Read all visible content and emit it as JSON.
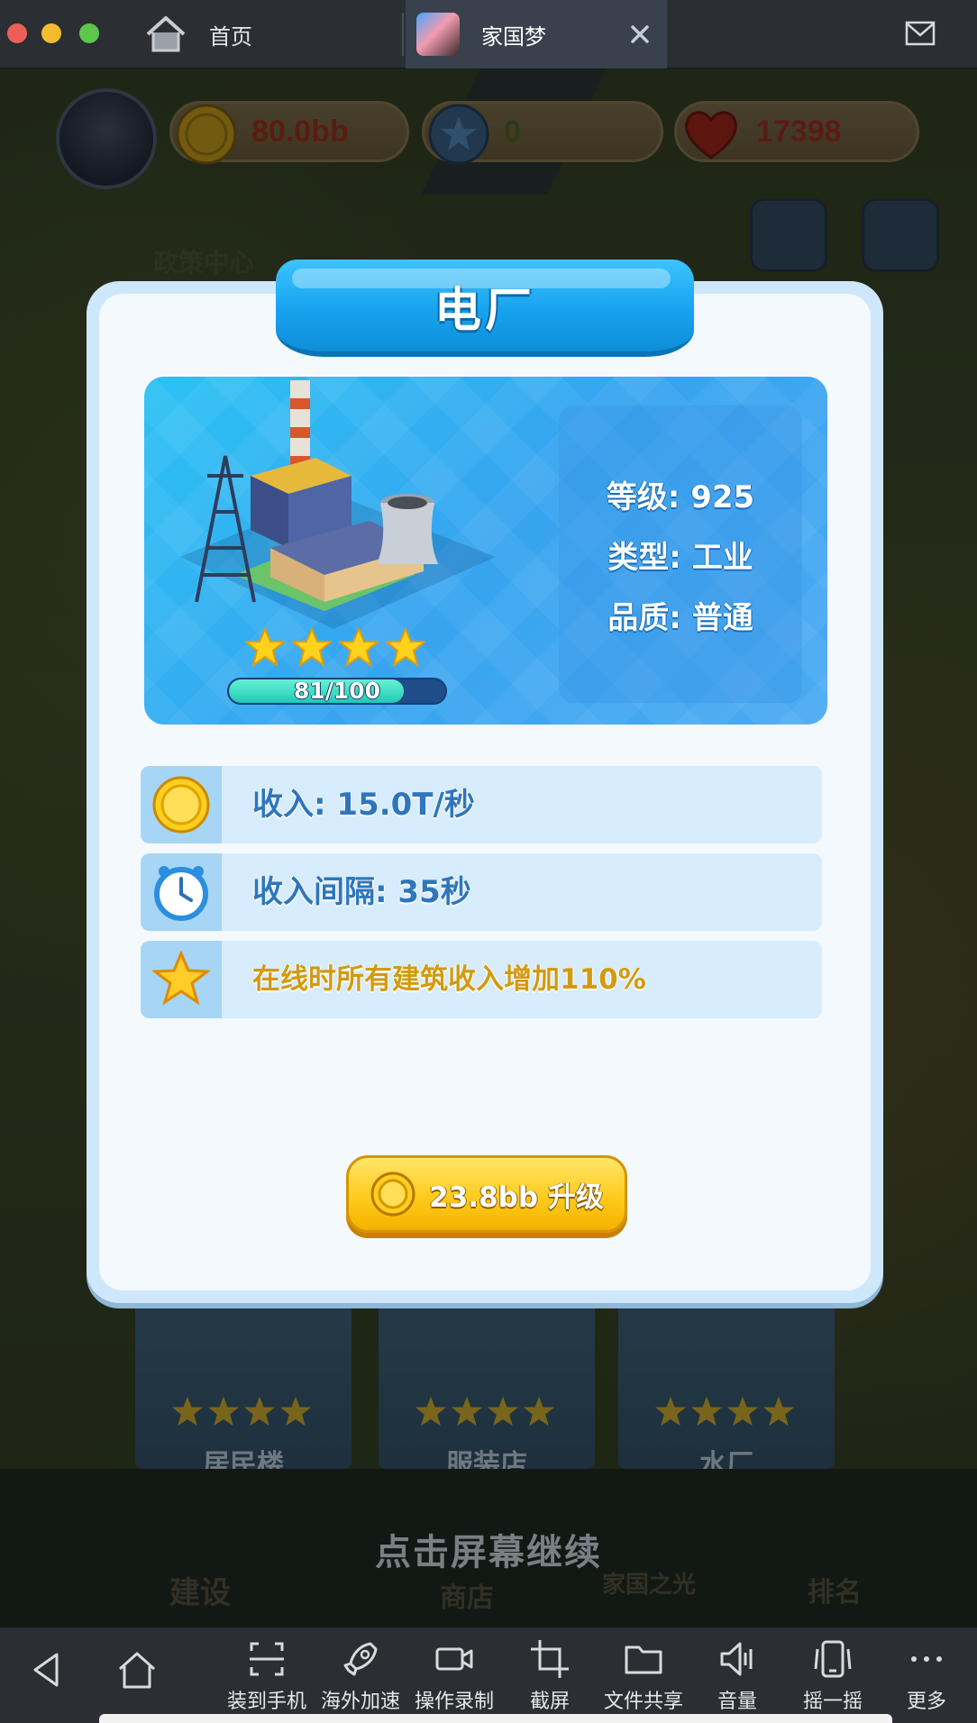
{
  "window": {
    "tabs": [
      {
        "label": "首页",
        "icon": "home-icon",
        "active": false
      },
      {
        "label": "家国梦",
        "icon": "app-icon",
        "active": true
      }
    ]
  },
  "resources": {
    "coins": "80.0bb",
    "gems": "0",
    "hearts": "17398"
  },
  "background_labels": {
    "policy_center": "政策中心"
  },
  "modal": {
    "title": "电厂",
    "level": "等级: 925",
    "type": "类型: 工业",
    "quality": "品质: 普通",
    "stars": 4,
    "progress_text": "81/100",
    "progress_value": 0.81,
    "rows": [
      {
        "icon": "coin-icon",
        "text": "收入: 15.0T/秒"
      },
      {
        "icon": "clock-icon",
        "text": "收入间隔: 35秒"
      },
      {
        "icon": "star-icon",
        "text": "在线时所有建筑收入增加110%"
      }
    ],
    "upgrade_cost": "23.8bb 升级"
  },
  "dim_cards": [
    {
      "label": "居民楼"
    },
    {
      "label": "服装店"
    },
    {
      "label": "水厂"
    }
  ],
  "bottom_nav": [
    {
      "label": "建设"
    },
    {
      "label": "商店"
    },
    {
      "label": "家国之光"
    },
    {
      "label": "排名"
    }
  ],
  "continue_hint": "点击屏幕继续",
  "toolbar": {
    "items": [
      {
        "label": "装到手机",
        "icon": "install-to-phone-icon"
      },
      {
        "label": "海外加速",
        "icon": "rocket-icon"
      },
      {
        "label": "操作录制",
        "icon": "video-record-icon"
      },
      {
        "label": "截屏",
        "icon": "crop-icon"
      },
      {
        "label": "文件共享",
        "icon": "folder-icon"
      },
      {
        "label": "音量",
        "icon": "volume-icon"
      },
      {
        "label": "摇一摇",
        "icon": "shake-icon"
      },
      {
        "label": "更多",
        "icon": "more-icon"
      }
    ]
  },
  "colors": {
    "banner": "#18a3ef",
    "button": "#ffcb1c",
    "progress": "#20c9b6"
  }
}
